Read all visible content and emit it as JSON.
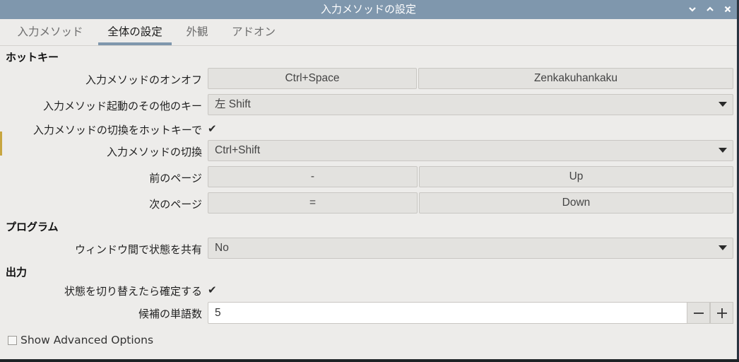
{
  "window": {
    "title": "入力メソッドの設定",
    "controls": {
      "minimize": "minimize",
      "maximize": "maximize",
      "close": "close"
    }
  },
  "tabs": [
    {
      "label": "入力メソッド",
      "active": false
    },
    {
      "label": "全体の設定",
      "active": true
    },
    {
      "label": "外観",
      "active": false
    },
    {
      "label": "アドオン",
      "active": false
    }
  ],
  "hotkey": {
    "heading": "ホットキー",
    "toggle": {
      "label": "入力メソッドのオンオフ",
      "key1": "Ctrl+Space",
      "key2": "Zenkakuhankaku"
    },
    "extra_trigger": {
      "label": "入力メソッド起動のその他のキー",
      "value": "左 Shift"
    },
    "enable_switch": {
      "label": "入力メソッドの切換をホットキーで",
      "checked": true,
      "mark": "✔"
    },
    "switch": {
      "label": "入力メソッドの切換",
      "value": "Ctrl+Shift"
    },
    "prev_page": {
      "label": "前のページ",
      "key1": "-",
      "key2": "Up"
    },
    "next_page": {
      "label": "次のページ",
      "key1": "=",
      "key2": "Down"
    }
  },
  "program": {
    "heading": "プログラム",
    "share_state": {
      "label": "ウィンドウ間で状態を共有",
      "value": "No"
    }
  },
  "output": {
    "heading": "出力",
    "commit_on_switch": {
      "label": "状態を切り替えたら確定する",
      "checked": true,
      "mark": "✔"
    },
    "candidate_count": {
      "label": "候補の単語数",
      "value": "5",
      "decrement": "−",
      "increment": "+"
    }
  },
  "advanced": {
    "label": "Show Advanced Options",
    "checked": false
  }
}
